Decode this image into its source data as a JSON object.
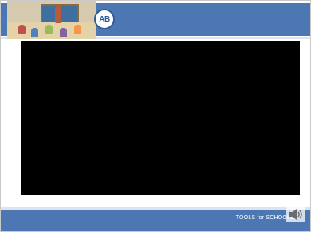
{
  "header": {
    "illustration": "classroom-illustration",
    "logo_text": "AB"
  },
  "main": {
    "video": "video-player"
  },
  "footer": {
    "text": "TOOLS for SCHOOLS",
    "icons": [
      "speaker-icon"
    ]
  },
  "colors": {
    "banner": "#4d77b3",
    "video_background": "#000000",
    "page_background": "#ffffff"
  }
}
